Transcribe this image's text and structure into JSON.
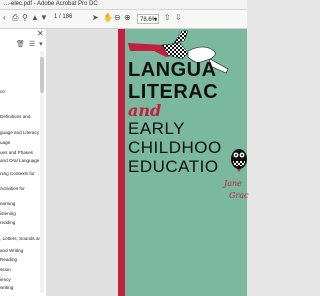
{
  "window": {
    "title": "...-elec.pdf - Adobe Acrobat Pro DC"
  },
  "toolbar": {
    "page_indicator": "1 / 186",
    "zoom": "78.6%",
    "icons": [
      "back-icon",
      "print-icon",
      "search-icon",
      "upload-icon",
      "download-icon",
      "page-up-icon",
      "page-down-icon",
      "select-icon",
      "hand-icon",
      "zoom-out-icon",
      "zoom-in-icon"
    ]
  },
  "sidebar": {
    "icons": [
      "delete-icon",
      "outline-icon",
      "options-icon"
    ],
    "bookmarks": [
      "ce",
      "Definitions and",
      "guage and Literacy",
      "uage",
      "ues and Phases",
      "and Oral Language",
      "ning Contexts for",
      "Activities for",
      "earning",
      "istening",
      "reading",
      ", Letters, Sounds and",
      "and Writing",
      "Reading",
      "ssion",
      "iency",
      "writing"
    ]
  },
  "cover": {
    "title_line1": "LANGUA",
    "title_line2": "LITERAC",
    "and": "and",
    "title_line3": "EARLY",
    "title_line4": "CHILDHOO",
    "title_line5": "EDUCATIO",
    "author_line1": "Jane",
    "author_line2": "Grac",
    "colors": {
      "background": "#7ab8a0",
      "accent": "#c3203f",
      "title": "#111111"
    }
  }
}
